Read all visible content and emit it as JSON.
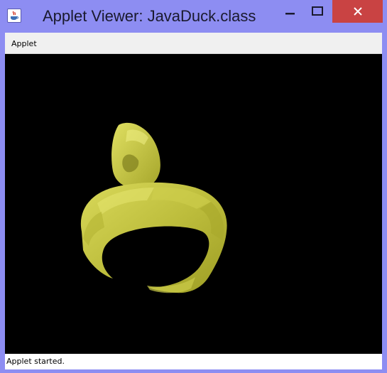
{
  "window": {
    "title": "Applet Viewer: JavaDuck.class",
    "app_icon": "java-cup-icon",
    "controls": [
      "minimize-icon",
      "maximize-icon",
      "close-icon"
    ],
    "colors": {
      "frame": "#8d8df2",
      "close": "#c94343",
      "model": "#c8c84a",
      "canvas": "#000000"
    }
  },
  "menubar": {
    "items": [
      {
        "label": "Applet"
      }
    ]
  },
  "status": {
    "text": "Applet started."
  }
}
